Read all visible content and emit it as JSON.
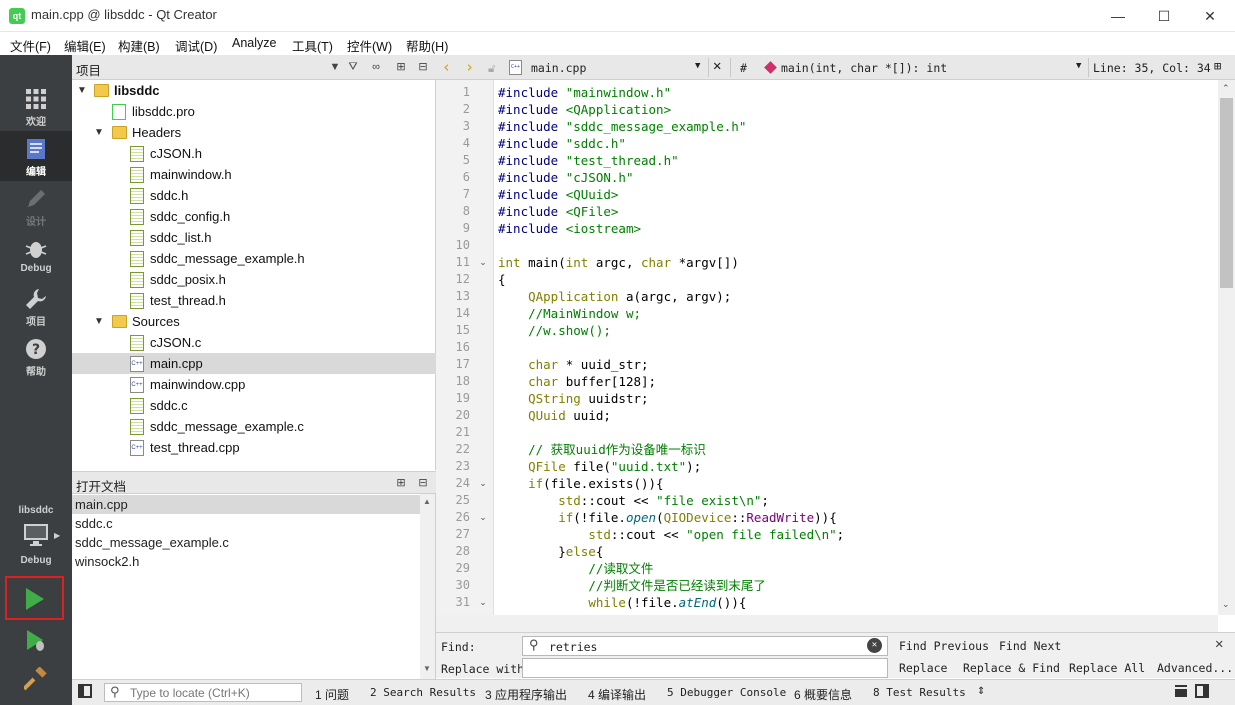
{
  "window": {
    "title": "main.cpp @ libsddc - Qt Creator",
    "app_icon": "qt",
    "controls": {
      "minimize": "—",
      "maximize": "☐",
      "close": "✕"
    }
  },
  "menu": [
    "文件(F)",
    "编辑(E)",
    "构建(B)",
    "调试(D)",
    "Analyze",
    "工具(T)",
    "控件(W)",
    "帮助(H)"
  ],
  "modes": {
    "welcome": "欢迎",
    "edit": "编辑",
    "design": "设计",
    "debug": "Debug",
    "projects": "项目",
    "help": "帮助",
    "kit_name": "libsddc",
    "kit_mode": "Debug"
  },
  "project_pane": {
    "title": "项目",
    "root": "libsddc",
    "pro_file": "libsddc.pro",
    "headers_label": "Headers",
    "headers": [
      "cJSON.h",
      "mainwindow.h",
      "sddc.h",
      "sddc_config.h",
      "sddc_list.h",
      "sddc_message_example.h",
      "sddc_posix.h",
      "test_thread.h"
    ],
    "sources_label": "Sources",
    "sources": [
      "cJSON.c",
      "main.cpp",
      "mainwindow.cpp",
      "sddc.c",
      "sddc_message_example.c",
      "test_thread.cpp"
    ],
    "selected": "main.cpp"
  },
  "open_docs": {
    "title": "打开文档",
    "items": [
      "main.cpp",
      "sddc.c",
      "sddc_message_example.c",
      "winsock2.h"
    ],
    "selected": "main.cpp"
  },
  "editor_toolbar": {
    "file": "main.cpp",
    "hash": "#",
    "symbol": "main(int, char *[]): int",
    "position": "Line: 35, Col: 34"
  },
  "code_lines": [
    [
      [
        "pre",
        "#include "
      ],
      [
        "str",
        "\"mainwindow.h\""
      ]
    ],
    [
      [
        "pre",
        "#include "
      ],
      [
        "str",
        "<QApplication>"
      ]
    ],
    [
      [
        "pre",
        "#include "
      ],
      [
        "str",
        "\"sddc_message_example.h\""
      ]
    ],
    [
      [
        "pre",
        "#include "
      ],
      [
        "str",
        "\"sddc.h\""
      ]
    ],
    [
      [
        "pre",
        "#include "
      ],
      [
        "str",
        "\"test_thread.h\""
      ]
    ],
    [
      [
        "pre",
        "#include "
      ],
      [
        "str",
        "\"cJSON.h\""
      ]
    ],
    [
      [
        "pre",
        "#include "
      ],
      [
        "str",
        "<QUuid>"
      ]
    ],
    [
      [
        "pre",
        "#include "
      ],
      [
        "str",
        "<QFile>"
      ]
    ],
    [
      [
        "pre",
        "#include "
      ],
      [
        "str",
        "<iostream>"
      ]
    ],
    [],
    [
      [
        "type",
        "int"
      ],
      [
        "n",
        " main("
      ],
      [
        "type",
        "int"
      ],
      [
        "n",
        " argc, "
      ],
      [
        "type",
        "char"
      ],
      [
        "n",
        " *argv[])"
      ]
    ],
    [
      [
        "n",
        "{"
      ]
    ],
    [
      [
        "n",
        "    "
      ],
      [
        "type",
        "QApplication"
      ],
      [
        "n",
        " a(argc, argv);"
      ]
    ],
    [
      [
        "n",
        "    "
      ],
      [
        "com",
        "//MainWindow w;"
      ]
    ],
    [
      [
        "n",
        "    "
      ],
      [
        "com",
        "//w.show();"
      ]
    ],
    [],
    [
      [
        "n",
        "    "
      ],
      [
        "type",
        "char"
      ],
      [
        "n",
        " * uuid_str;"
      ]
    ],
    [
      [
        "n",
        "    "
      ],
      [
        "type",
        "char"
      ],
      [
        "n",
        " buffer[128];"
      ]
    ],
    [
      [
        "n",
        "    "
      ],
      [
        "type",
        "QString"
      ],
      [
        "n",
        " uuidstr;"
      ]
    ],
    [
      [
        "n",
        "    "
      ],
      [
        "type",
        "QUuid"
      ],
      [
        "n",
        " uuid;"
      ]
    ],
    [],
    [
      [
        "n",
        "    "
      ],
      [
        "com",
        "// 获取uuid作为设备唯一标识"
      ]
    ],
    [
      [
        "n",
        "    "
      ],
      [
        "type",
        "QFile"
      ],
      [
        "n",
        " file("
      ],
      [
        "str",
        "\"uuid.txt\""
      ],
      [
        "n",
        ");"
      ]
    ],
    [
      [
        "n",
        "    "
      ],
      [
        "type",
        "if"
      ],
      [
        "n",
        "(file.exists()){"
      ]
    ],
    [
      [
        "n",
        "        "
      ],
      [
        "type",
        "std"
      ],
      [
        "n",
        "::cout << "
      ],
      [
        "str",
        "\"file exist\\n\""
      ],
      [
        "n",
        ";"
      ]
    ],
    [
      [
        "n",
        "        "
      ],
      [
        "type",
        "if"
      ],
      [
        "n",
        "(!file."
      ],
      [
        "fn",
        "open"
      ],
      [
        "n",
        "("
      ],
      [
        "type",
        "QIODevice"
      ],
      [
        "n",
        "::"
      ],
      [
        "enum",
        "ReadWrite"
      ],
      [
        "n",
        ")){"
      ]
    ],
    [
      [
        "n",
        "            "
      ],
      [
        "type",
        "std"
      ],
      [
        "n",
        "::cout << "
      ],
      [
        "str",
        "\"open file failed\\n\""
      ],
      [
        "n",
        ";"
      ]
    ],
    [
      [
        "n",
        "        }"
      ],
      [
        "type",
        "else"
      ],
      [
        "n",
        "{"
      ]
    ],
    [
      [
        "n",
        "            "
      ],
      [
        "com",
        "//读取文件"
      ]
    ],
    [
      [
        "n",
        "            "
      ],
      [
        "com",
        "//判断文件是否已经读到末尾了"
      ]
    ],
    [
      [
        "n",
        "            "
      ],
      [
        "type",
        "while"
      ],
      [
        "n",
        "(!file."
      ],
      [
        "fn",
        "atEnd"
      ],
      [
        "n",
        "()){"
      ]
    ]
  ],
  "fold_lines": [
    11,
    24,
    26,
    31
  ],
  "find_bar": {
    "find_label": "Find:",
    "replace_label": "Replace with:",
    "find_value": "retries",
    "replace_value": "",
    "find_previous": "Find Previous",
    "find_next": "Find Next",
    "replace": "Replace",
    "replace_find": "Replace & Find",
    "replace_all": "Replace All",
    "advanced": "Advanced..."
  },
  "status_bar": {
    "locator_placeholder": "Type to locate (Ctrl+K)",
    "tabs": [
      "1 问题",
      "2 Search Results",
      "3 应用程序输出",
      "4 编译输出",
      "5 Debugger Console",
      "6 概要信息",
      "8 Test Results"
    ]
  },
  "colors": {
    "modebar": "#3c3f41",
    "run_highlight": "#e02020",
    "run_green": "#3fae49"
  }
}
